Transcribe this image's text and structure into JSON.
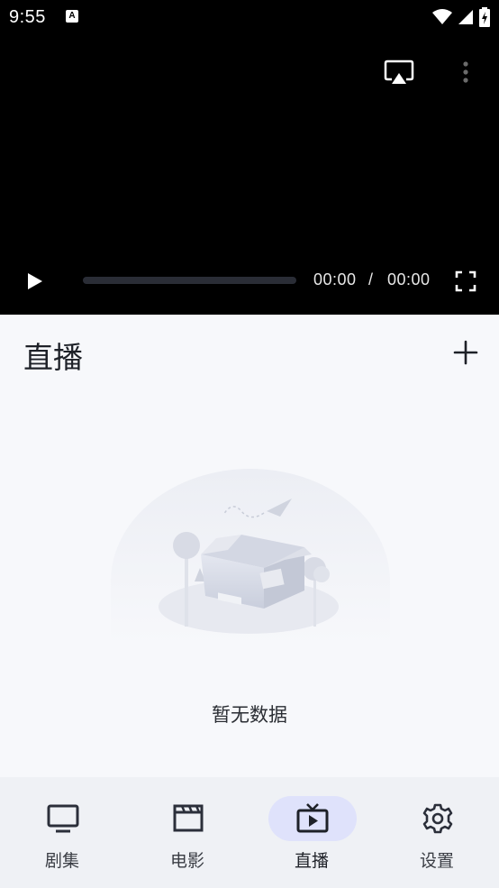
{
  "status_bar": {
    "time": "9:55",
    "notification": "A"
  },
  "player": {
    "current_time": "00:00",
    "separator": "/",
    "total_time": "00:00",
    "progress": 0
  },
  "section": {
    "title": "直播"
  },
  "empty_state": {
    "text": "暂无数据"
  },
  "bottom_nav": {
    "items": [
      {
        "label": "剧集",
        "icon": "tv-icon",
        "active": false
      },
      {
        "label": "电影",
        "icon": "clapperboard-icon",
        "active": false
      },
      {
        "label": "直播",
        "icon": "live-tv-icon",
        "active": true
      },
      {
        "label": "设置",
        "icon": "gear-icon",
        "active": false
      }
    ]
  },
  "colors": {
    "player_bg": "#000000",
    "page_bg": "#f7f8fb",
    "nav_bg": "#eff1f5",
    "nav_active_pill": "#dfe2fb",
    "icon_dark": "#2b2f3a"
  }
}
